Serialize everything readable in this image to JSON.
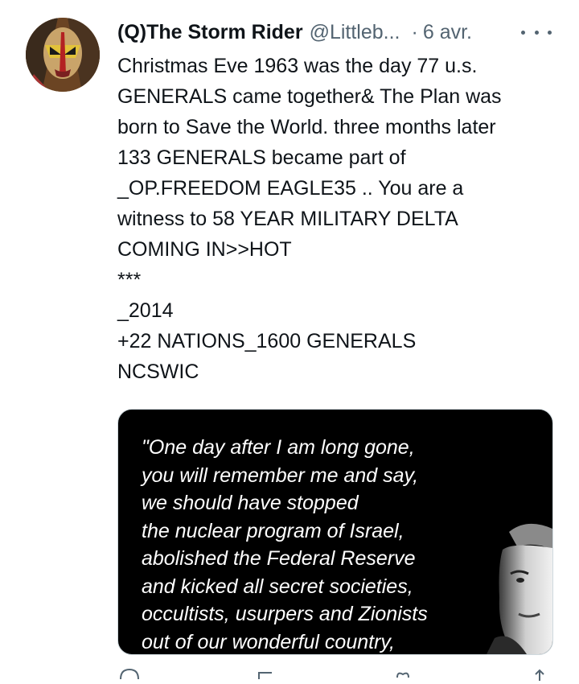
{
  "tweet": {
    "display_name": "(Q)The Storm Rider",
    "handle": "@Littleb...",
    "separator": "·",
    "date": "6 avr.",
    "text": "Christmas Eve 1963 was the day 77 u.s.\nGENERALS came together& The Plan was\nborn to Save the World. three months later\n133 GENERALS became part of\n_OP.FREEDOM EAGLE35 .. You are a\nwitness to 58 YEAR MILITARY DELTA\nCOMING IN>>HOT\n***\n_2014\n+22 NATIONS_1600 GENERALS\nNCSWIC"
  },
  "media": {
    "quote": "\"One day after I am long gone,\nyou will remember me and say,\nwe should have stopped\nthe nuclear program of Israel,\nabolished the Federal Reserve\nand kicked all secret societies,\noccultists, usurpers and Zionists\nout of our wonderful country,"
  },
  "icons": {
    "more": "more-dots-icon",
    "reply": "reply-icon",
    "retweet": "retweet-icon",
    "like": "like-icon",
    "share": "share-icon"
  },
  "colors": {
    "text": "#0f1419",
    "secondary": "#536471",
    "media_bg": "#000000"
  }
}
